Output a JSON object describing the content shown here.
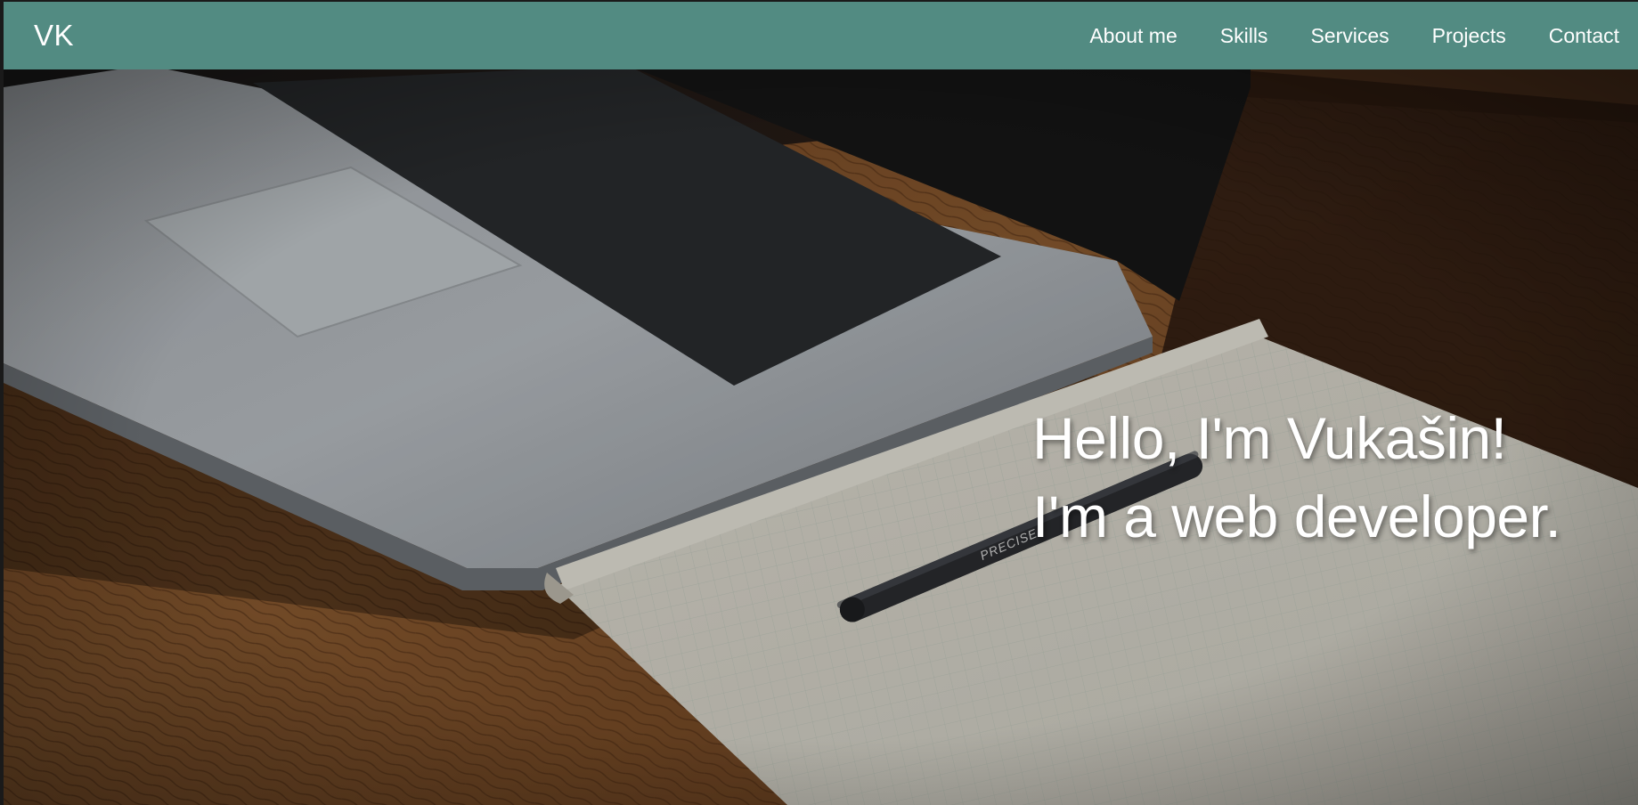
{
  "nav": {
    "logo": "VK",
    "items": [
      {
        "label": "About me"
      },
      {
        "label": "Skills"
      },
      {
        "label": "Services"
      },
      {
        "label": "Projects"
      },
      {
        "label": "Contact"
      }
    ]
  },
  "hero": {
    "line1": "Hello, I'm Vukašin!",
    "line2": "I'm a web developer.",
    "pen_label": "PRECISE"
  },
  "colors": {
    "navbar": "#528b82",
    "text": "#ffffff"
  }
}
